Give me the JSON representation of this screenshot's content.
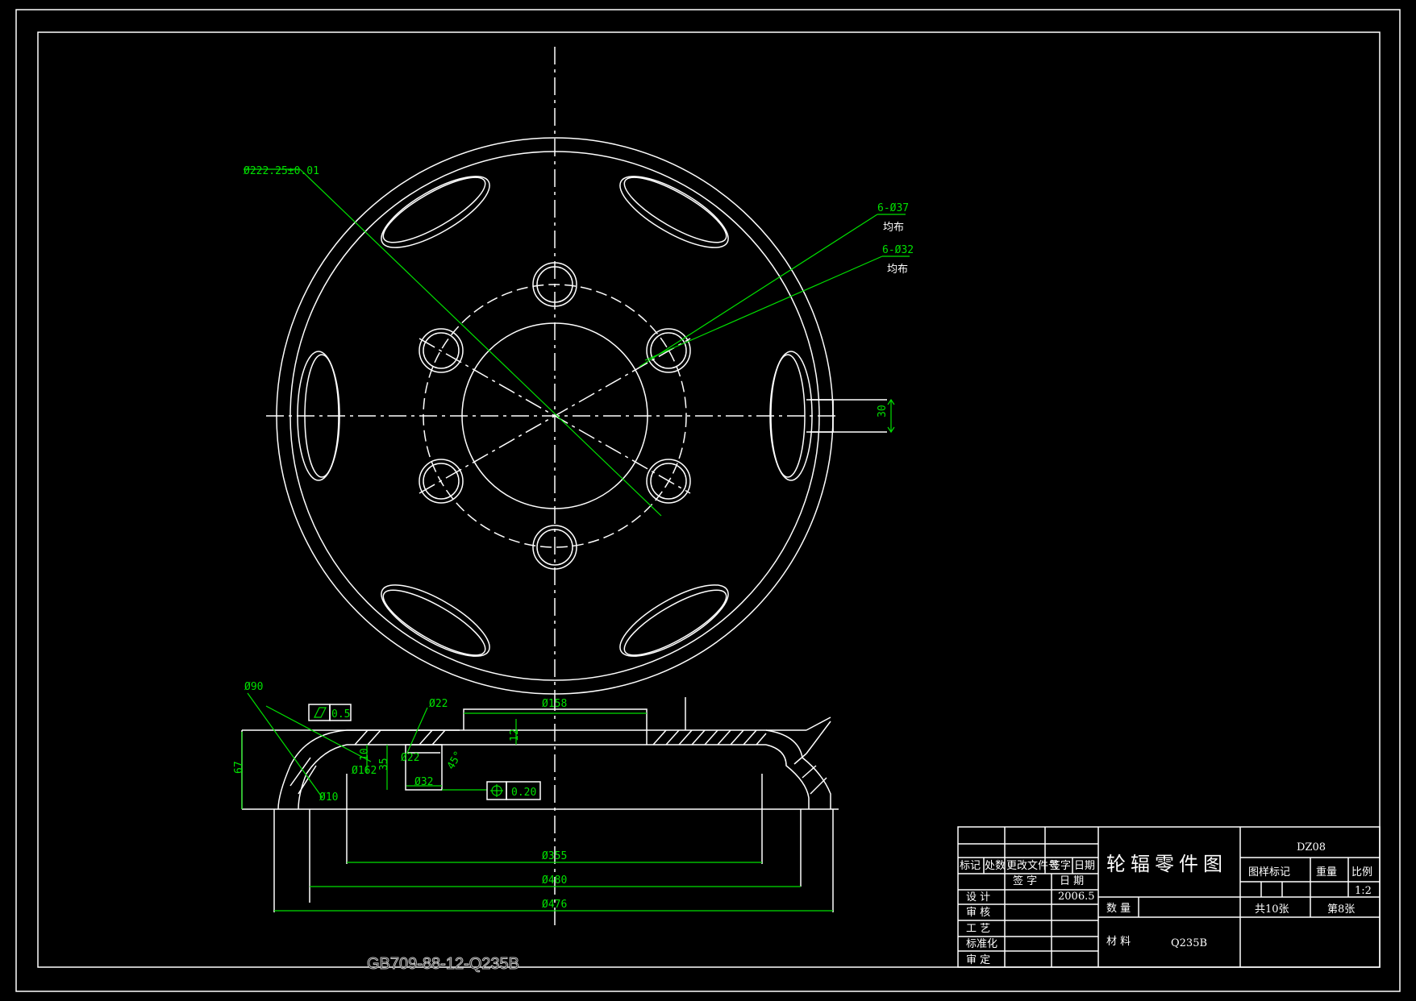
{
  "drawing": {
    "dimensions": {
      "pcd": "Ø222.25±0.01",
      "outer_holes_count": "6-Ø37",
      "outer_holes_note": "均布",
      "inner_holes_count": "6-Ø32",
      "inner_holes_note": "均布",
      "slot_width": "30",
      "d90": "Ø90",
      "flatness": "0.5",
      "d22_top": "Ø22",
      "d158": "Ø158",
      "d12": "12",
      "d67": "67",
      "d10": "10",
      "d35": "35",
      "d162": "Ø162",
      "d22": "Ø22",
      "d32": "Ø32",
      "angle": "45°",
      "position_tol": "0.20",
      "d10_small": "Ø10",
      "d355": "Ø355",
      "d480": "Ø480",
      "d476": "Ø476"
    },
    "standard_note": "GB709-88-12-Q235B"
  },
  "title_block": {
    "drawing_number": "DZ08",
    "title": "轮辐零件图",
    "headers": {
      "mark": "标记",
      "count": "处数",
      "change_doc": "更改文件号",
      "sign": "签字",
      "date": "日期",
      "sign2": "签 字",
      "date2": "日 期",
      "stage_mark": "图样标记",
      "weight": "重量",
      "scale": "比例"
    },
    "rows": {
      "design": "设 计",
      "check": "审 核",
      "process": "工 艺",
      "standard": "标准化",
      "approve": "审 定"
    },
    "design_date": "2006.5",
    "scale_value": "1:2",
    "quantity_label": "数 量",
    "material_label": "材 料",
    "material_value": "Q235B",
    "total_sheets": "共10张",
    "sheet_no": "第8张"
  }
}
